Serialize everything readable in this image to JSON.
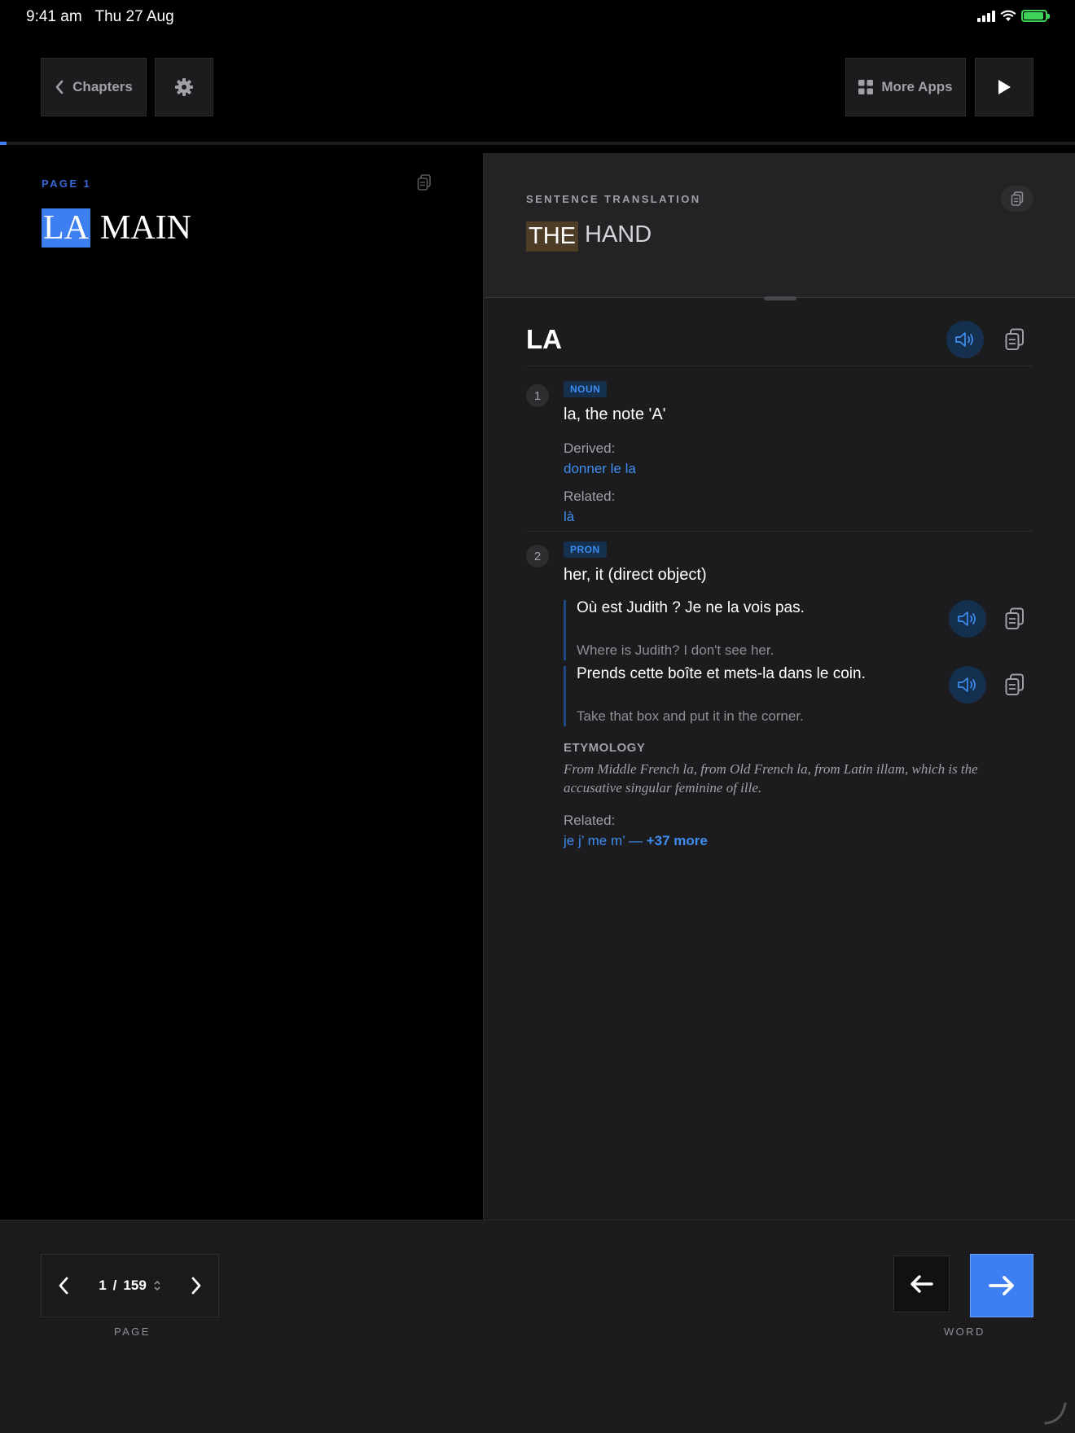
{
  "status_bar": {
    "time": "9:41 am",
    "date": "Thu 27 Aug"
  },
  "toolbar": {
    "chapters_label": "Chapters",
    "more_apps_label": "More Apps",
    "icons": {
      "back": "chevron-left-icon",
      "settings": "gear-icon",
      "apps": "grid-icon",
      "play": "play-icon"
    }
  },
  "reading_progress": 0.006,
  "left": {
    "page_label": "PAGE 1",
    "words": [
      {
        "text": "LA",
        "highlighted": true
      },
      {
        "text": "MAIN",
        "highlighted": false
      }
    ]
  },
  "translation": {
    "label": "SENTENCE TRANSLATION",
    "words": [
      {
        "text": "THE",
        "highlighted": true
      },
      {
        "text": "HAND",
        "highlighted": false
      }
    ]
  },
  "entry": {
    "word": "LA",
    "senses": [
      {
        "number": "1",
        "pos": "NOUN",
        "definition": "la, the note 'A'",
        "derived_label": "Derived:",
        "derived": "donner le la",
        "related_label": "Related:",
        "related": "là"
      },
      {
        "number": "2",
        "pos": "PRON",
        "definition": "her, it (direct object)",
        "examples": [
          {
            "fr": "Où est Judith ? Je ne la vois pas.",
            "en": "Where is Judith? I don't see her."
          },
          {
            "fr": "Prends cette boîte et mets-la dans le coin.",
            "en": "Take that box and put it in the corner."
          }
        ]
      }
    ],
    "etymology_title": "ETYMOLOGY",
    "etymology_text": "From Middle French la, from Old French la, from Latin illam, which is the accusative singular feminine of ille.",
    "related_label": "Related:",
    "related_links": "je j’ me m’ —",
    "related_more": "+37 more"
  },
  "bottom": {
    "page_current": "1",
    "page_separator": "/",
    "page_total": "159",
    "page_caption": "PAGE",
    "word_caption": "WORD"
  },
  "colors": {
    "accent": "#3d7ff0",
    "link": "#3d8df0",
    "translation_highlight": "#4e3d26",
    "battery": "#3ed25a"
  }
}
